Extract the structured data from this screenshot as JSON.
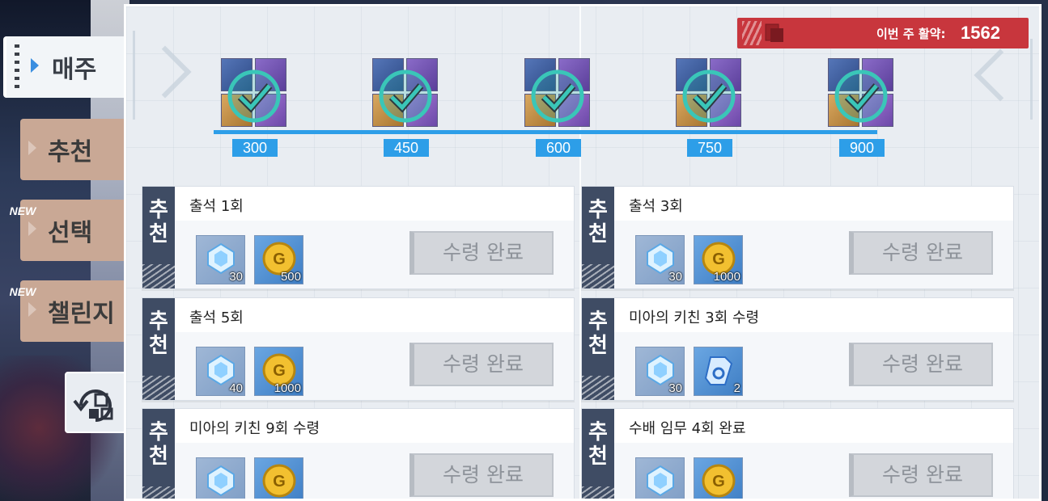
{
  "activity": {
    "label": "이번 주 활약:",
    "value": "1562"
  },
  "milestones": [
    {
      "value": "300",
      "claimed": true
    },
    {
      "value": "450",
      "claimed": true
    },
    {
      "value": "600",
      "claimed": true
    },
    {
      "value": "750",
      "claimed": true
    },
    {
      "value": "900",
      "claimed": true
    }
  ],
  "tabs": {
    "weekly": "매주",
    "recommend": "추천",
    "select": "선택",
    "challenge": "챌린지",
    "new_badge": "NEW"
  },
  "cards": [
    {
      "tag": "추천",
      "title": "출석 1회",
      "items": [
        {
          "icon": "crystal-icon",
          "qty": "30"
        },
        {
          "icon": "gold-coin-icon",
          "qty": "500"
        }
      ],
      "button": "수령 완료"
    },
    {
      "tag": "추천",
      "title": "출석 3회",
      "items": [
        {
          "icon": "crystal-icon",
          "qty": "30"
        },
        {
          "icon": "gold-coin-icon",
          "qty": "1000"
        }
      ],
      "button": "수령 완료"
    },
    {
      "tag": "추천",
      "title": "출석 5회",
      "items": [
        {
          "icon": "crystal-icon",
          "qty": "40"
        },
        {
          "icon": "gold-coin-icon",
          "qty": "1000"
        }
      ],
      "button": "수령 완료"
    },
    {
      "tag": "추천",
      "title": "미아의 키친 3회 수령",
      "items": [
        {
          "icon": "crystal-icon",
          "qty": "30"
        },
        {
          "icon": "blue-ticket-icon",
          "qty": "2"
        }
      ],
      "button": "수령 완료"
    },
    {
      "tag": "추천",
      "title": "미아의 키친 9회 수령",
      "items": [
        {
          "icon": "crystal-icon",
          "qty": ""
        },
        {
          "icon": "gold-coin-icon",
          "qty": ""
        }
      ],
      "button": "수령 완료"
    },
    {
      "tag": "추천",
      "title": "수배 임무 4회 완료",
      "items": [
        {
          "icon": "crystal-icon",
          "qty": ""
        },
        {
          "icon": "gold-coin-icon",
          "qty": ""
        }
      ],
      "button": "수령 완료"
    }
  ],
  "colors": {
    "accent": "#2d9ee8",
    "activity_bg": "#c8363d",
    "tab_bg": "#c9a895",
    "card_side": "#3f4c64"
  }
}
